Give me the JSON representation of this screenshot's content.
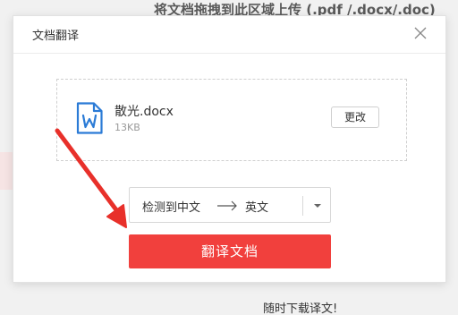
{
  "background": {
    "upload_hint": "将文档拖拽到此区域上传 (.pdf /.docx/.doc)",
    "footer_text": "随时下载译文!"
  },
  "dialog": {
    "title": "文档翻译",
    "close_icon": "close-icon",
    "file": {
      "name": "散光.docx",
      "size": "13KB",
      "icon": "word-doc-icon",
      "change_label": "更改"
    },
    "language": {
      "source": "检测到中文",
      "target": "英文",
      "arrow_icon": "arrow-right-icon",
      "dropdown_icon": "caret-down-icon"
    },
    "translate_button": "翻译文档"
  },
  "colors": {
    "accent": "#f1403d",
    "doc_icon": "#2b7bd6",
    "annotation": "#e8302a"
  }
}
